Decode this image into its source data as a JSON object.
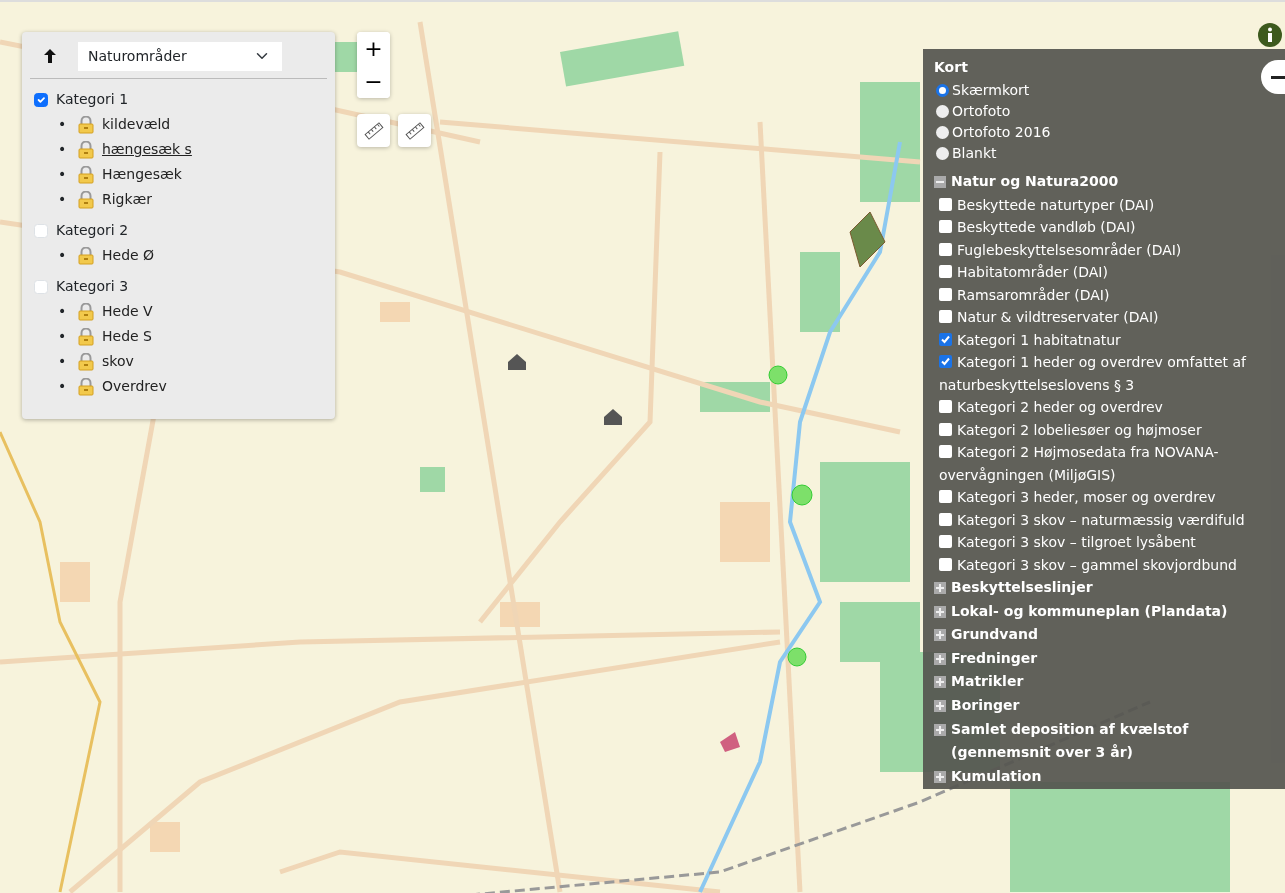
{
  "left_panel": {
    "dropdown": {
      "value": "Naturområder"
    },
    "categories": [
      {
        "label": "Kategori 1",
        "checked": true,
        "items": [
          {
            "marker": "•",
            "label": "kildevæld",
            "hovered": false
          },
          {
            "marker": "•",
            "label": "hængesæk s",
            "hovered": true
          },
          {
            "marker": "•",
            "label": "Hængesæk",
            "hovered": false
          },
          {
            "marker": "•",
            "label": "Rigkær",
            "hovered": false
          }
        ]
      },
      {
        "label": "Kategori 2",
        "checked": false,
        "items": [
          {
            "marker": "•",
            "label": "Hede Ø",
            "hovered": false
          }
        ]
      },
      {
        "label": "Kategori 3",
        "checked": false,
        "items": [
          {
            "marker": "•",
            "label": "Hede V",
            "hovered": false
          },
          {
            "marker": "•",
            "label": "Hede S",
            "hovered": false
          },
          {
            "marker": "•",
            "label": "skov",
            "hovered": false
          },
          {
            "marker": "•",
            "label": "Overdrev",
            "hovered": false
          }
        ]
      }
    ]
  },
  "zoom_controls": {
    "zoom_in": "+",
    "zoom_out": "−"
  },
  "layer_panel": {
    "title": "Kort",
    "basemaps": [
      {
        "label": "Skærmkort",
        "selected": true
      },
      {
        "label": "Ortofoto",
        "selected": false
      },
      {
        "label": "Ortofoto 2016",
        "selected": false
      },
      {
        "label": "Blankt",
        "selected": false
      }
    ],
    "groups": [
      {
        "label": "Natur og Natura2000",
        "expanded": true,
        "layers": [
          {
            "label": "Beskyttede naturtyper (DAI)",
            "checked": false
          },
          {
            "label": "Beskyttede vandløb (DAI)",
            "checked": false
          },
          {
            "label": "Fuglebeskyttelsesområder (DAI)",
            "checked": false
          },
          {
            "label": "Habitatområder (DAI)",
            "checked": false
          },
          {
            "label": "Ramsarområder (DAI)",
            "checked": false
          },
          {
            "label": "Natur & vildtreservater (DAI)",
            "checked": false
          },
          {
            "label": "Kategori 1 habitatnatur",
            "checked": true
          },
          {
            "label": "Kategori 1 heder og overdrev omfattet af naturbeskyttelseslovens § 3",
            "checked": true
          },
          {
            "label": "Kategori 2 heder og overdrev",
            "checked": false
          },
          {
            "label": "Kategori 2 lobeliesøer og højmoser",
            "checked": false
          },
          {
            "label": "Kategori 2 Højmosedata fra NOVANA-overvågningen (MiljøGIS)",
            "checked": false
          },
          {
            "label": "Kategori 3 heder, moser og overdrev",
            "checked": false
          },
          {
            "label": "Kategori 3 skov – naturmæssig værdifuld",
            "checked": false
          },
          {
            "label": "Kategori 3 skov – tilgroet lysåbent",
            "checked": false
          },
          {
            "label": "Kategori 3 skov – gammel skovjordbund",
            "checked": false
          }
        ]
      },
      {
        "label": "Beskyttelseslinjer",
        "expanded": false
      },
      {
        "label": "Lokal- og kommuneplan (Plandata)",
        "expanded": false
      },
      {
        "label": "Grundvand",
        "expanded": false
      },
      {
        "label": "Fredninger",
        "expanded": false
      },
      {
        "label": "Matrikler",
        "expanded": false
      },
      {
        "label": "Boringer",
        "expanded": false
      },
      {
        "label": "Samlet deposition af kvælstof (gennemsnit over 3 år)",
        "expanded": false
      },
      {
        "label": "Kumulation",
        "expanded": false
      }
    ]
  }
}
